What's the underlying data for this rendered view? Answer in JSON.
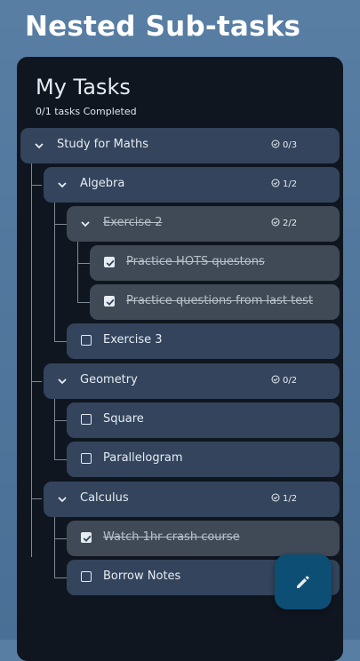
{
  "header": {
    "title": "Nested Sub-tasks"
  },
  "panel": {
    "title": "My Tasks",
    "progress": "0/1 tasks Completed"
  },
  "tasks": [
    {
      "label": "Study for Maths",
      "count": "0/3",
      "done": false,
      "expanded": true
    },
    {
      "label": "Algebra",
      "count": "1/2",
      "done": false,
      "expanded": true
    },
    {
      "label": "Exercise 2",
      "count": "2/2",
      "done": true,
      "expanded": true
    },
    {
      "label": "Practice HOTS questons",
      "done": true
    },
    {
      "label": "Practice questions from last test",
      "done": true
    },
    {
      "label": "Exercise 3",
      "done": false
    },
    {
      "label": "Geometry",
      "count": "0/2",
      "done": false,
      "expanded": true
    },
    {
      "label": "Square",
      "done": false
    },
    {
      "label": "Parallelogram",
      "done": false
    },
    {
      "label": "Calculus",
      "count": "1/2",
      "done": false,
      "expanded": true
    },
    {
      "label": "Watch 1hr crash course",
      "done": true
    },
    {
      "label": "Borrow Notes",
      "done": false
    }
  ],
  "fab": {
    "icon": "edit-pencil-icon"
  },
  "icons": {
    "expand": "chevron-down-icon",
    "count": "check-circle-icon"
  }
}
